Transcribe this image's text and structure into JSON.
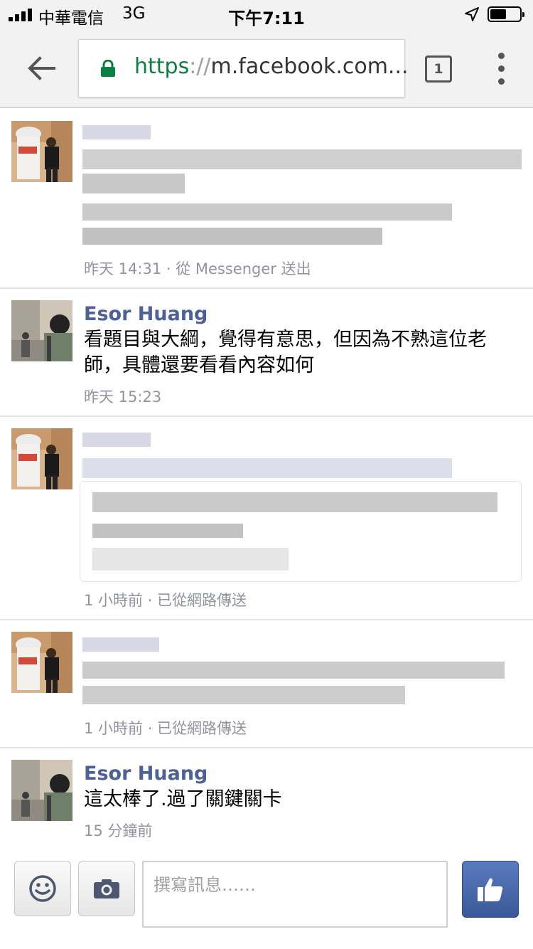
{
  "status_bar": {
    "carrier": "中華電信",
    "network": "3G",
    "time": "下午7:11"
  },
  "browser": {
    "url_scheme": "https",
    "url_separator": "://",
    "url_host": "m.facebook.com...",
    "tab_count": "1"
  },
  "messages": [
    {
      "sender": "",
      "text": "",
      "meta": "昨天 14:31 · 從 Messenger 送出"
    },
    {
      "sender": "Esor Huang",
      "text": "看題目與大綱，覺得有意思，但因為不熟這位老師，具體還要看看內容如何",
      "meta": "昨天 15:23"
    },
    {
      "sender": "",
      "text": "",
      "meta": "1 小時前 · 已從網路傳送"
    },
    {
      "sender": "",
      "text": "",
      "meta": "1 小時前 · 已從網路傳送"
    },
    {
      "sender": "Esor Huang",
      "text": "這太棒了.過了關鍵關卡",
      "meta": "15 分鐘前"
    }
  ],
  "composer": {
    "placeholder": "撰寫訊息……"
  },
  "icons": {
    "back": "arrow-left-icon",
    "lock": "lock-icon",
    "menu": "more-vertical-icon",
    "location": "location-arrow-icon",
    "emoji": "smiley-icon",
    "camera": "camera-icon",
    "like": "thumbs-up-icon"
  },
  "colors": {
    "secure_green": "#0b8043",
    "sender_blue": "#4b6198",
    "like_blue": "#3b5998"
  }
}
